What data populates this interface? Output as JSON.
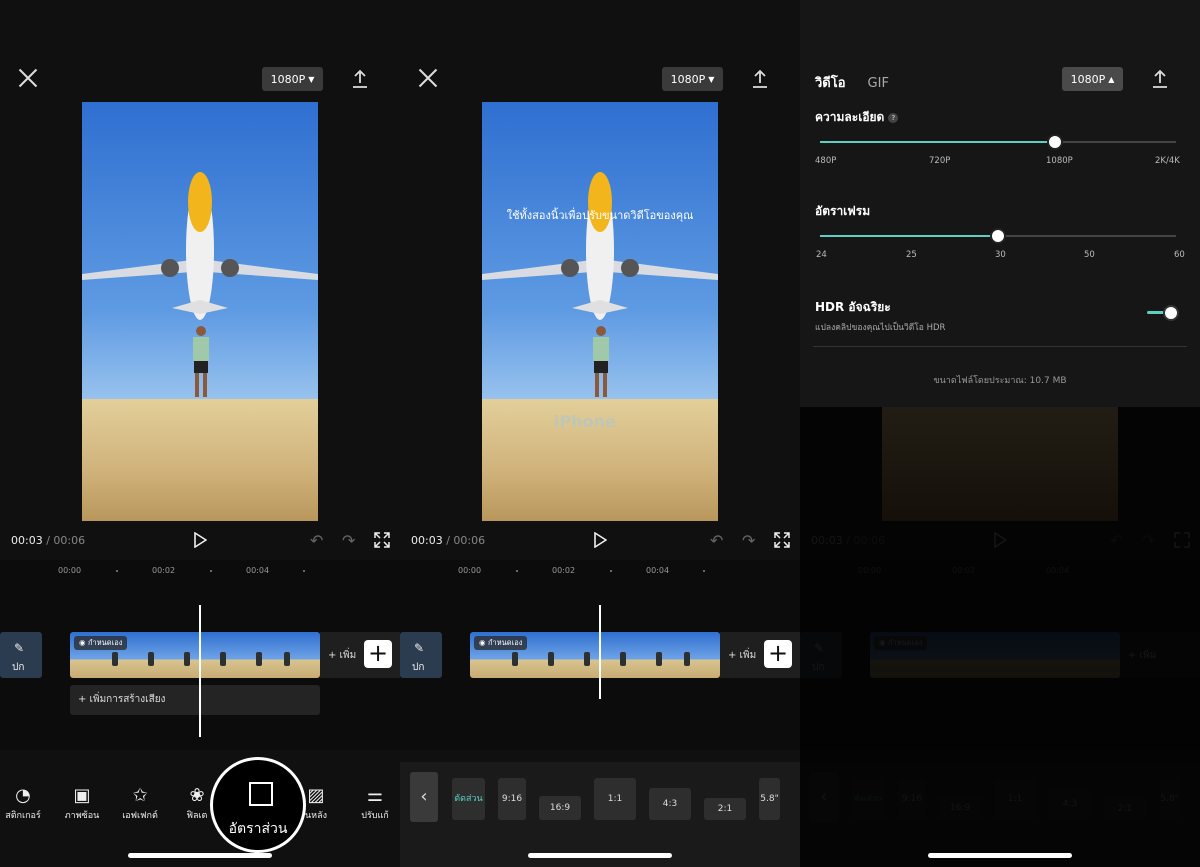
{
  "resolution_label": "1080P",
  "time_current": "00:03",
  "time_sep": "/",
  "time_total": "00:06",
  "ruler_labels": [
    "00:00",
    "00:02",
    "00:04"
  ],
  "clip_tag": "กำหนดเอง",
  "side_clip_label": "ปก",
  "add_clip_label": "+ เพิ่ม",
  "add_audio_label": "+ เพิ่มการสร้างเสียง",
  "tools": [
    "สติกเกอร์",
    "ภาพซ้อน",
    "เอฟเฟกต์",
    "ฟิลเต",
    "",
    "นหลัง",
    "ปรับแก้"
  ],
  "highlight_tool": "อัตราส่วน",
  "overlay_text": "ใช้ทั้งสองนิ้วเพื่อปรับขนาดวิดีโอของคุณ",
  "watermark": "iPhone",
  "ratios": [
    "ตัดส่วน",
    "9:16",
    "16:9",
    "1:1",
    "4:3",
    "2:1",
    "5.8\""
  ],
  "settings": {
    "tabs": [
      "วิดีโอ",
      "GIF"
    ],
    "resolution_title": "ความละเอียด",
    "resolution_ticks": [
      "480P",
      "720P",
      "1080P",
      "2K/4K"
    ],
    "resolution_value": 0.66,
    "framerate_title": "อัตราเฟรม",
    "framerate_ticks": [
      "24",
      "25",
      "30",
      "50",
      "60"
    ],
    "framerate_value": 0.5,
    "hdr_title": "HDR อัจฉริยะ",
    "hdr_sub": "แปลงคลิปของคุณไปเป็นวิดีโอ HDR",
    "hdr_on": true,
    "file_size": "ขนาดไฟล์โดยประมาณ: 10.7 MB"
  }
}
